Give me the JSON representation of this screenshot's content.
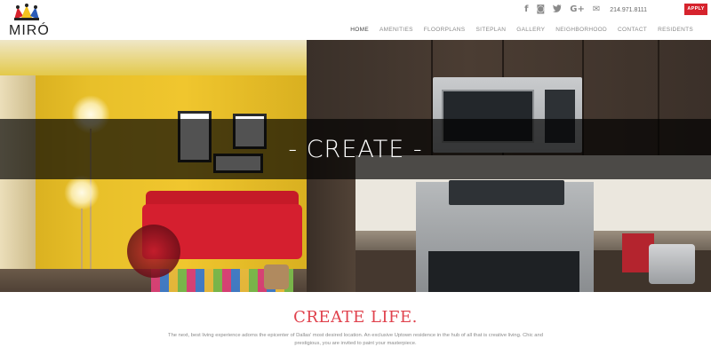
{
  "brand": {
    "logo_text": "MIRÓ"
  },
  "header": {
    "social_icons": [
      {
        "name": "facebook-icon",
        "glyph": "f"
      },
      {
        "name": "instagram-icon",
        "glyph": "◙"
      },
      {
        "name": "twitter-icon",
        "glyph": "🐦"
      },
      {
        "name": "google-plus-icon",
        "glyph": "G+"
      },
      {
        "name": "mail-icon",
        "glyph": "✉"
      }
    ],
    "phone": "214.971.8111",
    "apply_label": "APPLY",
    "apply_color": "#d6232d"
  },
  "nav": {
    "items": [
      {
        "label": "HOME",
        "active": true
      },
      {
        "label": "AMENITIES",
        "active": false
      },
      {
        "label": "FLOORPLANS",
        "active": false
      },
      {
        "label": "SITEPLAN",
        "active": false
      },
      {
        "label": "GALLERY",
        "active": false
      },
      {
        "label": "NEIGHBORHOOD",
        "active": false
      },
      {
        "label": "CONTACT",
        "active": false
      },
      {
        "label": "RESIDENTS",
        "active": false
      }
    ]
  },
  "hero": {
    "banner_text": "- CREATE -"
  },
  "content": {
    "headline": "CREATE LIFE.",
    "headline_color": "#e0424d",
    "description": "The next, best living experience adorns the epicenter of Dallas' most desired location. An exclusive Uptown residence in the hub of all that is creative living. Chic and prestigious, you are invited to paint your masterpiece."
  }
}
